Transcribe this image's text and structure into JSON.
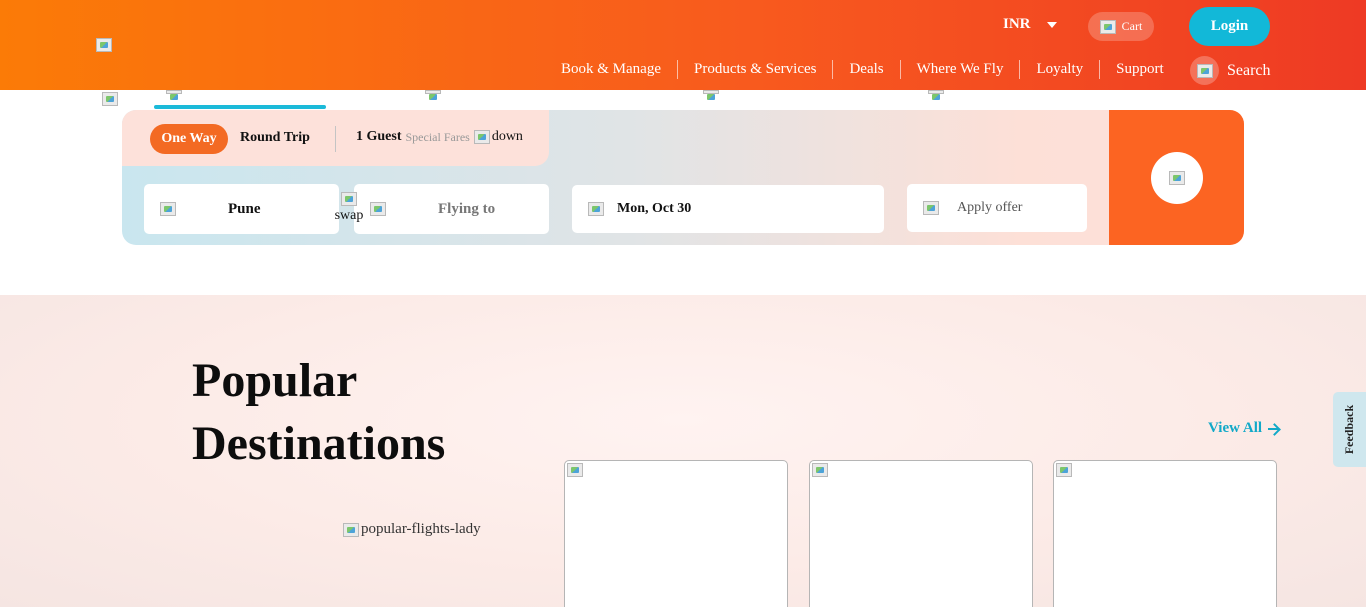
{
  "header": {
    "currency": "INR",
    "cart_label": "Cart",
    "login_label": "Login",
    "search_label": "Search",
    "nav": [
      "Book & Manage",
      "Products & Services",
      "Deals",
      "Where We Fly",
      "Loyalty",
      "Support"
    ]
  },
  "booking": {
    "trip_types": {
      "one_way": "One Way",
      "round_trip": "Round Trip"
    },
    "guests": {
      "count": "1 Guest",
      "special": "Special Fares",
      "down_alt": "down"
    },
    "from": "Pune",
    "swap_alt": "swap",
    "to_placeholder": "Flying to",
    "date": "Mon, Oct 30",
    "offer_placeholder": "Apply offer"
  },
  "popular": {
    "title": "Popular Destinations",
    "lady_alt": "popular-flights-lady",
    "view_all": "View All"
  },
  "feedback": "Feedback",
  "colors": {
    "header_start": "#fb7b07",
    "header_end": "#ee3a24",
    "accent_teal": "#12b8d8",
    "accent_orange": "#fc6422"
  }
}
